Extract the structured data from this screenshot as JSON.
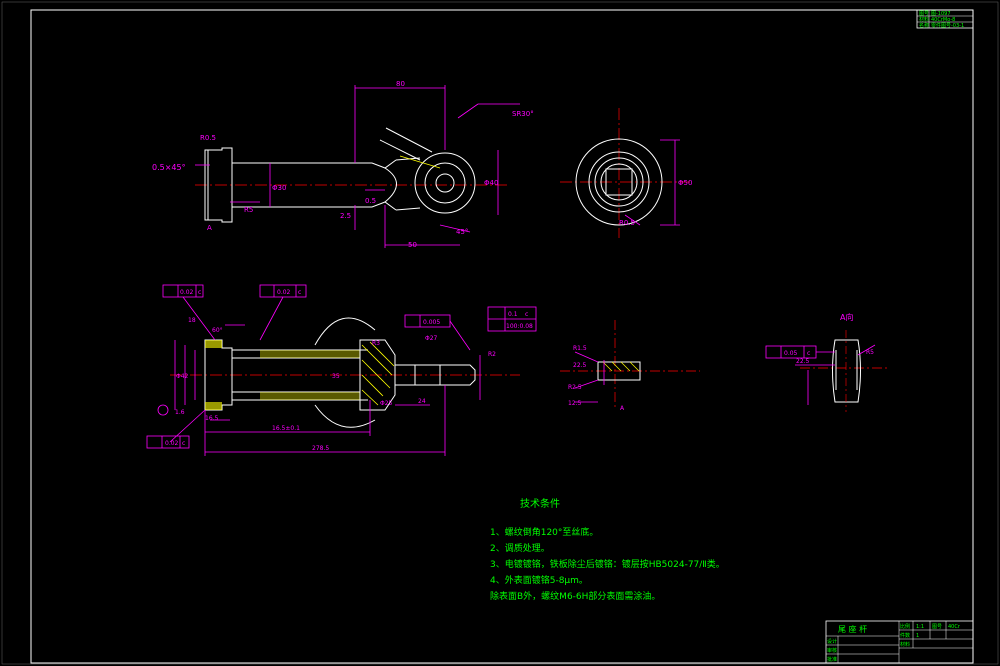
{
  "dims": {
    "d80": "80",
    "sr30": "SR30°",
    "chamfer": "0.5×45°",
    "r05": "R0.5",
    "d40": "Φ40",
    "d50": "50",
    "a45": "45°",
    "d2_5": "2.5",
    "d30": "Φ30",
    "r5": "R5",
    "b06": "R5",
    "d0_5": "0.5",
    "d18": "18",
    "d60": "60°",
    "d16_5": "16.5",
    "d15": "15",
    "d35": "35",
    "len1": "16.5±0.1",
    "len2": "Φ27",
    "total": "278.5",
    "d24": "24",
    "r3": "R3",
    "r2": "R2",
    "r15": "R15",
    "r11": "R1.5",
    "d0_3": "0.3",
    "d22_5": "22.5",
    "d12_5": "12.5",
    "mark_a": "A",
    "a_view": "A向",
    "r8": "R8",
    "ra": "Ra",
    "tol1": "0.02",
    "tol2": "0.01",
    "tol3": "0.005",
    "tol4": "0.02",
    "tol5": "0.02",
    "tol6": "0.05",
    "tol7": "100:0.08",
    "tol8": "0.1",
    "ref_c": "C",
    "ref_c2": "c",
    "phi42": "Φ42",
    "phi25": "Φ25",
    "d2": "2",
    "d0_1": "0.1",
    "d1_6": "1.6",
    "r2_5": "R2.5",
    "phi50": "Φ50"
  },
  "title_block_top": {
    "r1c1": "图号",
    "r1c2": "图-1097",
    "r2c1": "材料",
    "r2c2": "40CrMo-8",
    "r3c1": "名称",
    "r3c2": "零件图号-03-1"
  },
  "title_block_bottom": {
    "title": "尾 座 杆",
    "row1": "设计",
    "row2": "审核",
    "row3": "批准",
    "c1": "比例",
    "c2": "1:1",
    "c3": "图号",
    "c4": "件数",
    "c5": "1",
    "c6": "材料",
    "c7": "40Cr"
  },
  "tech_req": {
    "title": "技术条件",
    "items": [
      "1、螺纹倒角120°至丝底。",
      "2、调质处理。",
      "3、电镀镀铬，铁板除尘后镀铬：镀层按HB5024-77/Ⅱ类。",
      "4、外表面镀铬5-8μm。",
      "除表面B外，螺纹M6-6H部分表面需涂油。"
    ]
  },
  "colors": {
    "outline": "#ffffff",
    "dimension": "#ff00ff",
    "centerline": "#ff0000",
    "hatch": "#ffff00",
    "text": "#00ff00",
    "leader": "#00ffff"
  }
}
